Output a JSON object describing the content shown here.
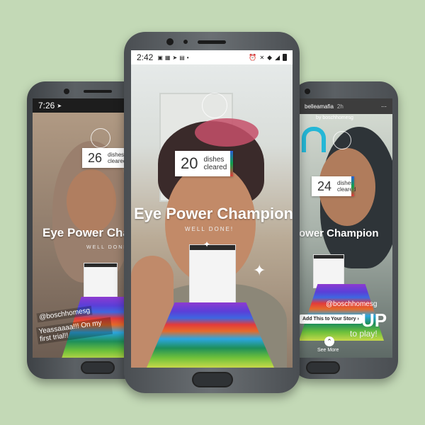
{
  "phones": {
    "left": {
      "status_time": "7:26",
      "dishes_count": "26",
      "dishes_label": "dishes cleared",
      "title": "Eye Power Cha",
      "subtitle": "WELL DONE!",
      "mention": "@boschhomesg",
      "caption": "Yeassaaaa!!! On my first trial!!"
    },
    "center": {
      "status_time": "2:42",
      "dishes_count": "20",
      "dishes_label": "dishes cleared",
      "title": "Eye Power Champion",
      "subtitle": "WELL DONE!"
    },
    "right": {
      "username": "belleamafia",
      "timestamp": "2h",
      "via_text": "by boschhomesg",
      "dishes_count": "24",
      "dishes_label": "dishes cleared",
      "title": "ower Champion",
      "mention": "@boschhomesg",
      "add_story_label": "Add This to Your Story",
      "big_text": "UP",
      "to_play": "to play!",
      "see_more": "See More"
    }
  },
  "colors": {
    "background": "#c3d9b6",
    "phone_body": "#4a4e52"
  }
}
